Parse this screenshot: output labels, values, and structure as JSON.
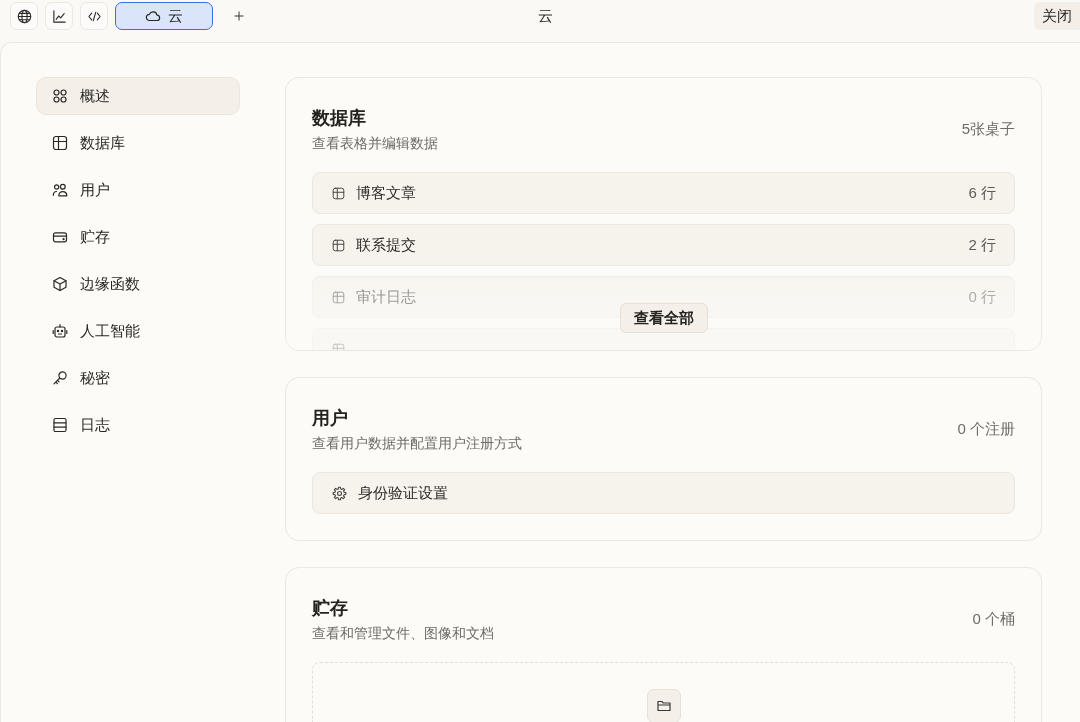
{
  "window": {
    "title": "云",
    "close_button": "关闭"
  },
  "tabs": [
    {
      "label": "云",
      "selected": true
    }
  ],
  "sidebar": {
    "items": [
      {
        "label": "概述",
        "selected": true
      },
      {
        "label": "数据库",
        "selected": false
      },
      {
        "label": "用户",
        "selected": false
      },
      {
        "label": "贮存",
        "selected": false
      },
      {
        "label": "边缘函数",
        "selected": false
      },
      {
        "label": "人工智能",
        "selected": false
      },
      {
        "label": "秘密",
        "selected": false
      },
      {
        "label": "日志",
        "selected": false
      }
    ]
  },
  "sections": [
    {
      "title": "数据库",
      "description": "查看表格并编辑数据",
      "count": "5张桌子",
      "empty": false,
      "rows": [
        {
          "kind": "table",
          "label": "博客文章",
          "count": "6 行"
        },
        {
          "kind": "table",
          "label": "联系提交",
          "count": "2 行"
        },
        {
          "kind": "table",
          "label": "审计日志",
          "count": "0 行"
        },
        {
          "kind": "table"
        }
      ],
      "show_all": "查看全部"
    },
    {
      "title": "用户",
      "description": "查看用户数据并配置用户注册方式",
      "count": "0 个注册",
      "empty": false,
      "rows": [
        {
          "kind": "settings",
          "label": "身份验证设置"
        }
      ]
    },
    {
      "title": "贮存",
      "description": "查看和管理文件、图像和文档",
      "count": "0 个桶",
      "empty": true
    }
  ]
}
